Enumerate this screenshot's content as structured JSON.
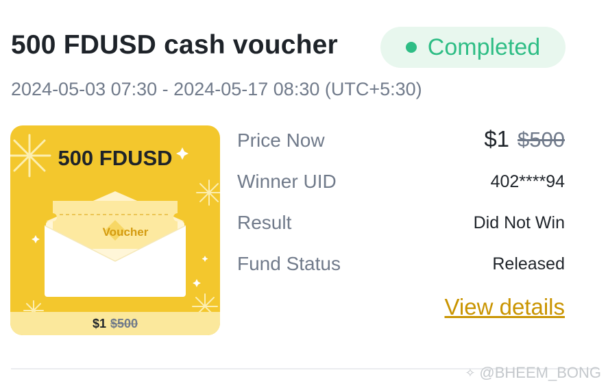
{
  "header": {
    "title": "500 FDUSD cash voucher",
    "status": "Completed",
    "period": "2024-05-03 07:30 - 2024-05-17 08:30 (UTC+5:30)"
  },
  "card": {
    "title": "500 FDUSD",
    "voucher_label": "Voucher",
    "price": "$1",
    "original_price": "$500"
  },
  "details": {
    "price_now": {
      "label": "Price Now",
      "value": "$1",
      "original": "$500"
    },
    "winner_uid": {
      "label": "Winner UID",
      "value": "402****94"
    },
    "result": {
      "label": "Result",
      "value": "Did Not Win"
    },
    "fund_status": {
      "label": "Fund Status",
      "value": "Released"
    }
  },
  "link": {
    "view_details": "View details"
  },
  "watermark": {
    "text": "@BHEEM_BONG"
  },
  "colors": {
    "status_green": "#2ebd85",
    "status_bg": "#e8f7ee",
    "link_gold": "#c99400",
    "card_yellow": "#f3c72d"
  }
}
